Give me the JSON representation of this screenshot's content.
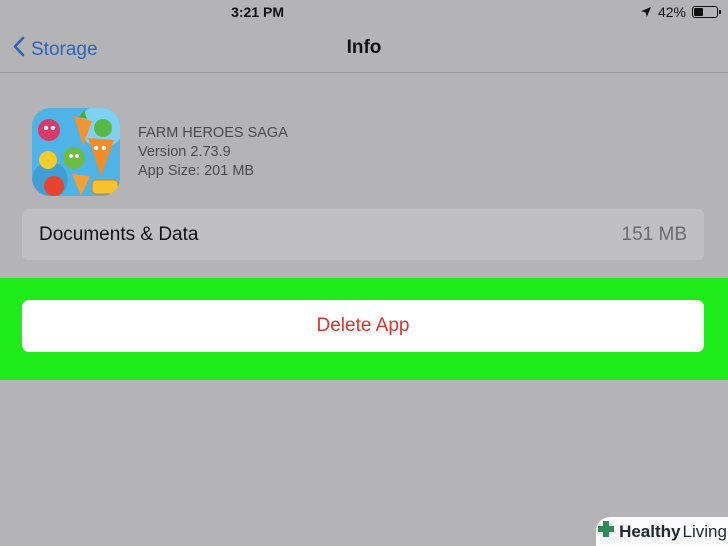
{
  "status_bar": {
    "time": "3:21 PM",
    "battery": "42%",
    "battery_level": 0.42
  },
  "nav": {
    "back_label": "Storage",
    "title": "Info"
  },
  "app": {
    "name": "FARM HEROES SAGA",
    "version": "Version 2.73.9",
    "size": "App Size: 201 MB"
  },
  "documents": {
    "label": "Documents & Data",
    "value": "151 MB"
  },
  "actions": {
    "delete_label": "Delete App"
  },
  "watermark": {
    "text_a": "Healthy",
    "text_b": "Living"
  },
  "colors": {
    "accent": "#2e64b8",
    "destructive": "#e0312b",
    "highlight": "#1fea1a"
  }
}
